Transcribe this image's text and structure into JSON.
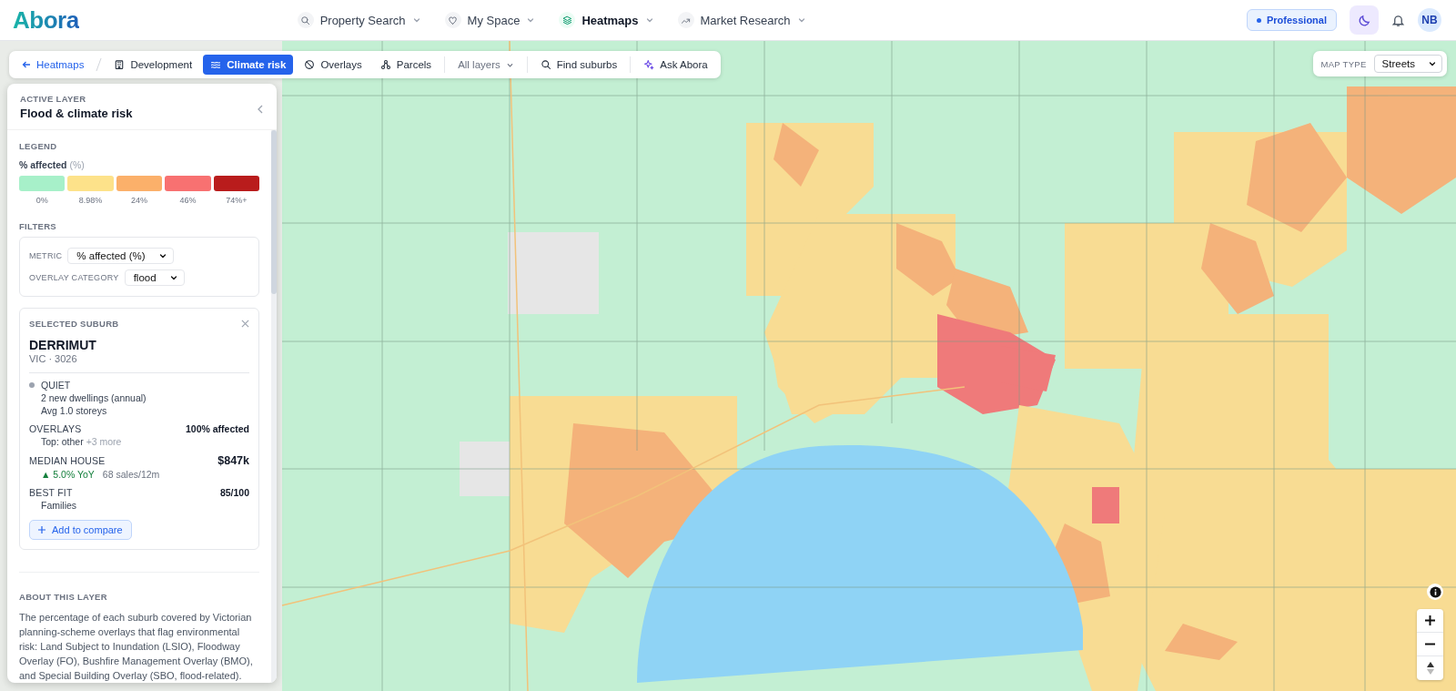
{
  "header": {
    "logo": "Abora",
    "nav": [
      {
        "label": "Property Search",
        "selected": false
      },
      {
        "label": "My Space",
        "selected": false
      },
      {
        "label": "Heatmaps",
        "selected": true
      },
      {
        "label": "Market Research",
        "selected": false
      }
    ],
    "plan_badge": "Professional",
    "avatar": "NB"
  },
  "toolbar": {
    "back": "Heatmaps",
    "layers": [
      {
        "label": "Development",
        "selected": false
      },
      {
        "label": "Climate risk",
        "selected": true
      },
      {
        "label": "Overlays",
        "selected": false
      },
      {
        "label": "Parcels",
        "selected": false
      }
    ],
    "layers_dropdown": "All layers",
    "actions": [
      {
        "label": "Find suburbs"
      },
      {
        "label": "Ask Abora"
      }
    ]
  },
  "map_type": {
    "label": "MAP TYPE",
    "value": "Streets"
  },
  "panel": {
    "eyebrow": "ACTIVE LAYER",
    "title": "Flood & climate risk",
    "legend": {
      "heading": "LEGEND",
      "metric": "% affected",
      "unit": "(%)",
      "swatches": [
        {
          "label": "0%",
          "color": "#a7f0c9"
        },
        {
          "label": "8.98%",
          "color": "#fde28a"
        },
        {
          "label": "24%",
          "color": "#fbb06a"
        },
        {
          "label": "46%",
          "color": "#f87171"
        },
        {
          "label": "74%+",
          "color": "#b91c1c"
        }
      ]
    },
    "filters": {
      "heading": "FILTERS",
      "fields": [
        {
          "label": "METRIC",
          "value": "% affected (%)"
        },
        {
          "label": "OVERLAY CATEGORY",
          "value": "flood"
        }
      ]
    },
    "suburb": {
      "heading": "SELECTED SUBURB",
      "name": "DERRIMUT",
      "region": "VIC · 3026",
      "status": "QUIET",
      "status_lines": [
        "2 new dwellings (annual)",
        "Avg 1.0 storeys"
      ],
      "stats": [
        {
          "label": "OVERLAYS",
          "value": "100% affected",
          "detail": "Top: other",
          "extra": "+3 more"
        },
        {
          "label": "MEDIAN HOUSE",
          "value": "$847k",
          "trend": "▲ 5.0% YoY",
          "detail": "68 sales/12m"
        },
        {
          "label": "BEST FIT",
          "value": "85/100",
          "detail": "Families"
        }
      ],
      "compare_button": "Add to compare"
    },
    "about": {
      "heading": "ABOUT THIS LAYER",
      "text": "The percentage of each suburb covered by Victorian planning-scheme overlays that flag environmental risk: Land Subject to Inundation (LSIO), Floodway Overlay (FO), Bushfire Management Overlay (BMO), and Special Building Overlay (SBO, flood-related)."
    }
  }
}
